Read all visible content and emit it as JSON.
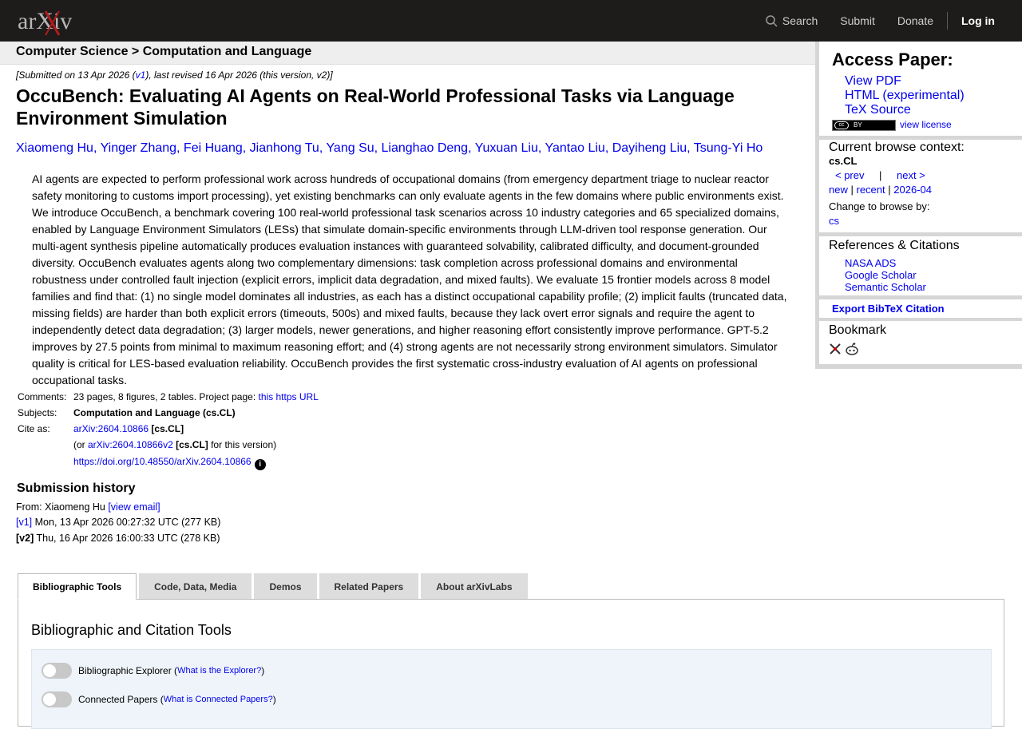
{
  "header": {
    "logo_text": "arXiv",
    "nav": {
      "search": "Search",
      "submit": "Submit",
      "donate": "Donate",
      "login": "Log in"
    }
  },
  "breadcrumb": "Computer Science > Computation and Language",
  "paper": {
    "submitted": {
      "prefix": "[Submitted on 13 Apr 2026 (",
      "v1": "v1",
      "suffix": "), last revised 16 Apr 2026 (this version, v2)]"
    },
    "title": "OccuBench: Evaluating AI Agents on Real-World Professional Tasks via Language Environment Simulation",
    "authors": [
      "Xiaomeng Hu",
      "Yinger Zhang",
      "Fei Huang",
      "Jianhong Tu",
      "Yang Su",
      "Lianghao Deng",
      "Yuxuan Liu",
      "Yantao Liu",
      "Dayiheng Liu",
      "Tsung-Yi Ho"
    ],
    "abstract": "AI agents are expected to perform professional work across hundreds of occupational domains (from emergency department triage to nuclear reactor safety monitoring to customs import processing), yet existing benchmarks can only evaluate agents in the few domains where public environments exist. We introduce OccuBench, a benchmark covering 100 real-world professional task scenarios across 10 industry categories and 65 specialized domains, enabled by Language Environment Simulators (LESs) that simulate domain-specific environments through LLM-driven tool response generation. Our multi-agent synthesis pipeline automatically produces evaluation instances with guaranteed solvability, calibrated difficulty, and document-grounded diversity. OccuBench evaluates agents along two complementary dimensions: task completion across professional domains and environmental robustness under controlled fault injection (explicit errors, implicit data degradation, and mixed faults). We evaluate 15 frontier models across 8 model families and find that: (1) no single model dominates all industries, as each has a distinct occupational capability profile; (2) implicit faults (truncated data, missing fields) are harder than both explicit errors (timeouts, 500s) and mixed faults, because they lack overt error signals and require the agent to independently detect data degradation; (3) larger models, newer generations, and higher reasoning effort consistently improve performance. GPT-5.2 improves by 27.5 points from minimal to maximum reasoning effort; and (4) strong agents are not necessarily strong environment simulators. Simulator quality is critical for LES-based evaluation reliability. OccuBench provides the first systematic cross-industry evaluation of AI agents on professional occupational tasks.",
    "meta": {
      "comments_label": "Comments:",
      "comments_text": "23 pages, 8 figures, 2 tables. Project page: ",
      "comments_link": "this https URL",
      "subjects_label": "Subjects:",
      "subjects_value": "Computation and Language (cs.CL)",
      "cite_label": "Cite as:",
      "cite_id": "arXiv:2604.10866",
      "cite_cat": "[cs.CL]",
      "cite_or": "(or ",
      "cite_v2": "arXiv:2604.10866v2",
      "cite_v2_cat": "[cs.CL]",
      "cite_v2_suffix": " for this version)",
      "doi": "https://doi.org/10.48550/arXiv.2604.10866",
      "info_glyph": "i"
    },
    "history": {
      "title": "Submission history",
      "from_prefix": "From: Xiaomeng Hu ",
      "view_email": "[view email]",
      "v1_tag": "[v1]",
      "v1_text": " Mon, 13 Apr 2026 00:27:32 UTC (277 KB)",
      "v2_tag": "[v2]",
      "v2_text": " Thu, 16 Apr 2026 16:00:33 UTC (278 KB)"
    }
  },
  "sidebar": {
    "access_title": "Access Paper:",
    "links": [
      "View PDF",
      "HTML (experimental)",
      "TeX Source"
    ],
    "license_badge": {
      "cc": "cc",
      "by": "BY"
    },
    "view_license": "view license",
    "context": {
      "title": "Current browse context:",
      "value": "cs.CL",
      "prev": "< prev",
      "sep": "|",
      "next": "next >",
      "new": "new",
      "recent": "recent",
      "month": "2026-04",
      "pipe": "|",
      "change_label": "Change to browse by:",
      "cs": "cs"
    },
    "refs": {
      "title": "References & Citations",
      "items": [
        "NASA ADS",
        "Google Scholar",
        "Semantic Scholar"
      ]
    },
    "bibtex": "Export BibTeX Citation",
    "bookmark": "Bookmark"
  },
  "tabs": [
    "Bibliographic Tools",
    "Code, Data, Media",
    "Demos",
    "Related Papers",
    "About arXivLabs"
  ],
  "panel": {
    "title": "Bibliographic and Citation Tools",
    "tools": [
      {
        "label": "Bibliographic Explorer (",
        "link": "What is the Explorer?",
        "close": ")"
      },
      {
        "label": "Connected Papers (",
        "link": "What is Connected Papers?",
        "close": ")"
      }
    ]
  }
}
